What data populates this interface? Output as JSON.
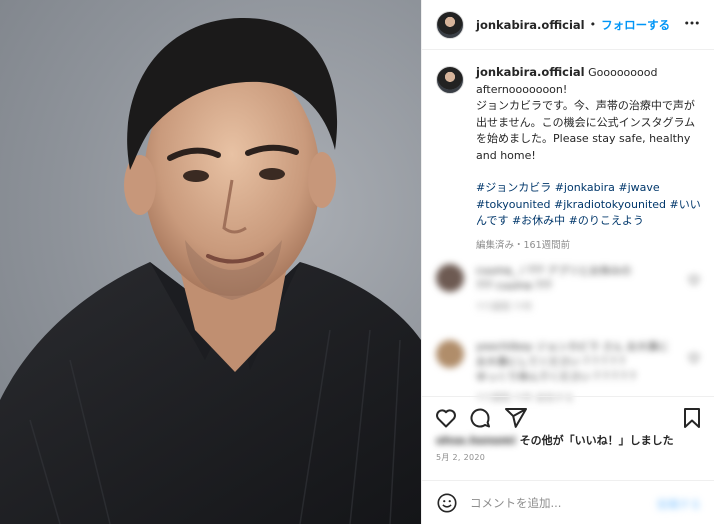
{
  "header": {
    "username": "jonkabira.official",
    "separator": "•",
    "follow_label": "フォローする",
    "more_icon": "more-horizontal-icon"
  },
  "caption": {
    "username": "jonkabira.official",
    "line1": "Gooooooood afternooooooon!",
    "line2": "ジョンカビラです。今、声帯の治療中で声が出せません。この機会に公式インスタグラムを始めました。Please stay safe, healthy and home!",
    "hashtags": "#ジョンカビラ #jonkabira #jwave #tokyounited #jkradiotokyounited #いいんです #お休み中 #のりこえよう",
    "meta": "編集済み・161週間前"
  },
  "comments": [
    {
      "text": "cuuma_ / ??? アプリとお休みの",
      "text2": "??? cuuma ???",
      "meta": "???週間 ??件",
      "avatar_color": "#6d5a52"
    },
    {
      "text": "yoochiiboy ジョンカビラ さん お大事に",
      "text2": "お大事にしてください ? ? ? ? ?",
      "text3": "ゆっくり休んでください ? ? ? ? ?",
      "meta": "???週間 ??件 返信する",
      "avatar_color": "#b08d6a"
    }
  ],
  "actions": {
    "like_icon": "heart-icon",
    "comment_icon": "comment-icon",
    "share_icon": "share-icon",
    "save_icon": "bookmark-icon"
  },
  "likes": {
    "blurred_name": "ohse.honomi",
    "text": "その他が「いいね！」しました"
  },
  "date": "5月 2, 2020",
  "add_comment": {
    "emoji_icon": "emoji-icon",
    "placeholder": "コメントを追加...",
    "post_label": "投稿する"
  },
  "colors": {
    "accent": "#0095f6",
    "hashtag": "#00376b",
    "muted": "#8e8e8e"
  }
}
